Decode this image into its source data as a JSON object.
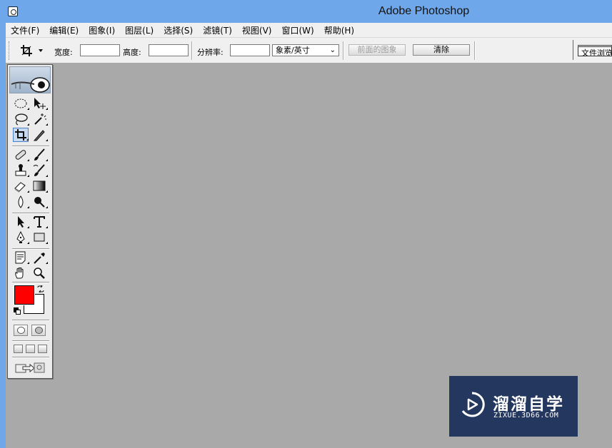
{
  "window": {
    "title": "Adobe Photoshop",
    "icon": "photoshop-app-icon"
  },
  "menubar": {
    "items": [
      "文件(F)",
      "编辑(E)",
      "图象(I)",
      "图层(L)",
      "选择(S)",
      "滤镜(T)",
      "视图(V)",
      "窗口(W)",
      "帮助(H)"
    ]
  },
  "options": {
    "tool_icon": "crop-icon",
    "width_label": "宽度:",
    "width_value": "",
    "height_label": "高度:",
    "height_value": "",
    "resolution_label": "分辨率:",
    "resolution_value": "",
    "unit_select": "象素/英寸",
    "front_image_button": "前面的图象",
    "clear_button": "清除",
    "palette_tab": "文件浏览器"
  },
  "toolbox": {
    "tools": [
      "elliptical-marquee-icon",
      "move-icon",
      "lasso-icon",
      "magic-wand-icon",
      "crop-icon",
      "slice-icon",
      "healing-brush-icon",
      "brush-icon",
      "clone-stamp-icon",
      "history-brush-icon",
      "eraser-icon",
      "gradient-icon",
      "blur-icon",
      "dodge-icon",
      "path-selection-icon",
      "type-icon",
      "pen-icon",
      "rectangle-shape-icon",
      "notes-icon",
      "eyedropper-icon",
      "hand-icon",
      "zoom-icon"
    ],
    "active_tool": "crop-icon",
    "foreground_color": "#ff0000",
    "background_color": "#ffffff"
  },
  "colors": {
    "titlebar": "#6fa8ea",
    "workspace": "#a9a9a9",
    "watermark_bg": "#24375e"
  },
  "watermark": {
    "title": "溜溜自学",
    "subtitle": "ZIXUE.3D66.COM"
  }
}
